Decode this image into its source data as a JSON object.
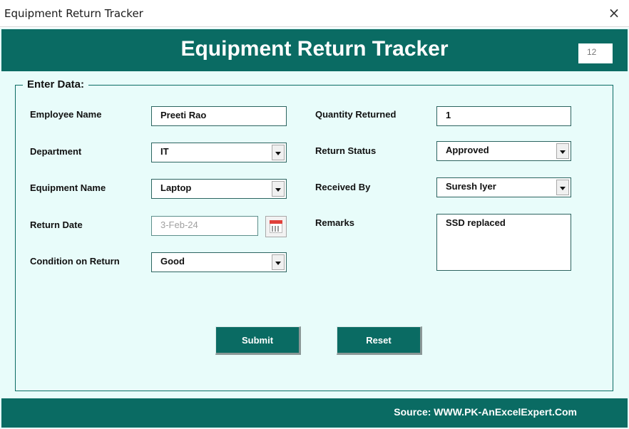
{
  "window": {
    "title": "Equipment Return Tracker",
    "close_icon": "×"
  },
  "header": {
    "title": "Equipment Return Tracker",
    "record_id": "12"
  },
  "group": {
    "legend": "Enter Data:"
  },
  "fields": {
    "employee_name": {
      "label": "Employee Name",
      "value": "Preeti Rao"
    },
    "department": {
      "label": "Department",
      "value": "IT"
    },
    "equipment_name": {
      "label": "Equipment Name",
      "value": "Laptop"
    },
    "return_date": {
      "label": "Return Date",
      "value": "3-Feb-24"
    },
    "condition": {
      "label": "Condition on Return",
      "value": "Good"
    },
    "quantity": {
      "label": "Quantity Returned",
      "value": "1"
    },
    "status": {
      "label": "Return Status",
      "value": "Approved"
    },
    "received_by": {
      "label": "Received By",
      "value": "Suresh Iyer"
    },
    "remarks": {
      "label": "Remarks",
      "value": "SSD replaced"
    }
  },
  "buttons": {
    "submit": "Submit",
    "reset": "Reset"
  },
  "footer": {
    "source": "Source: WWW.PK-AnExcelExpert.Com"
  },
  "colors": {
    "accent": "#0a6b63",
    "form_bg": "#e8fcfa"
  }
}
